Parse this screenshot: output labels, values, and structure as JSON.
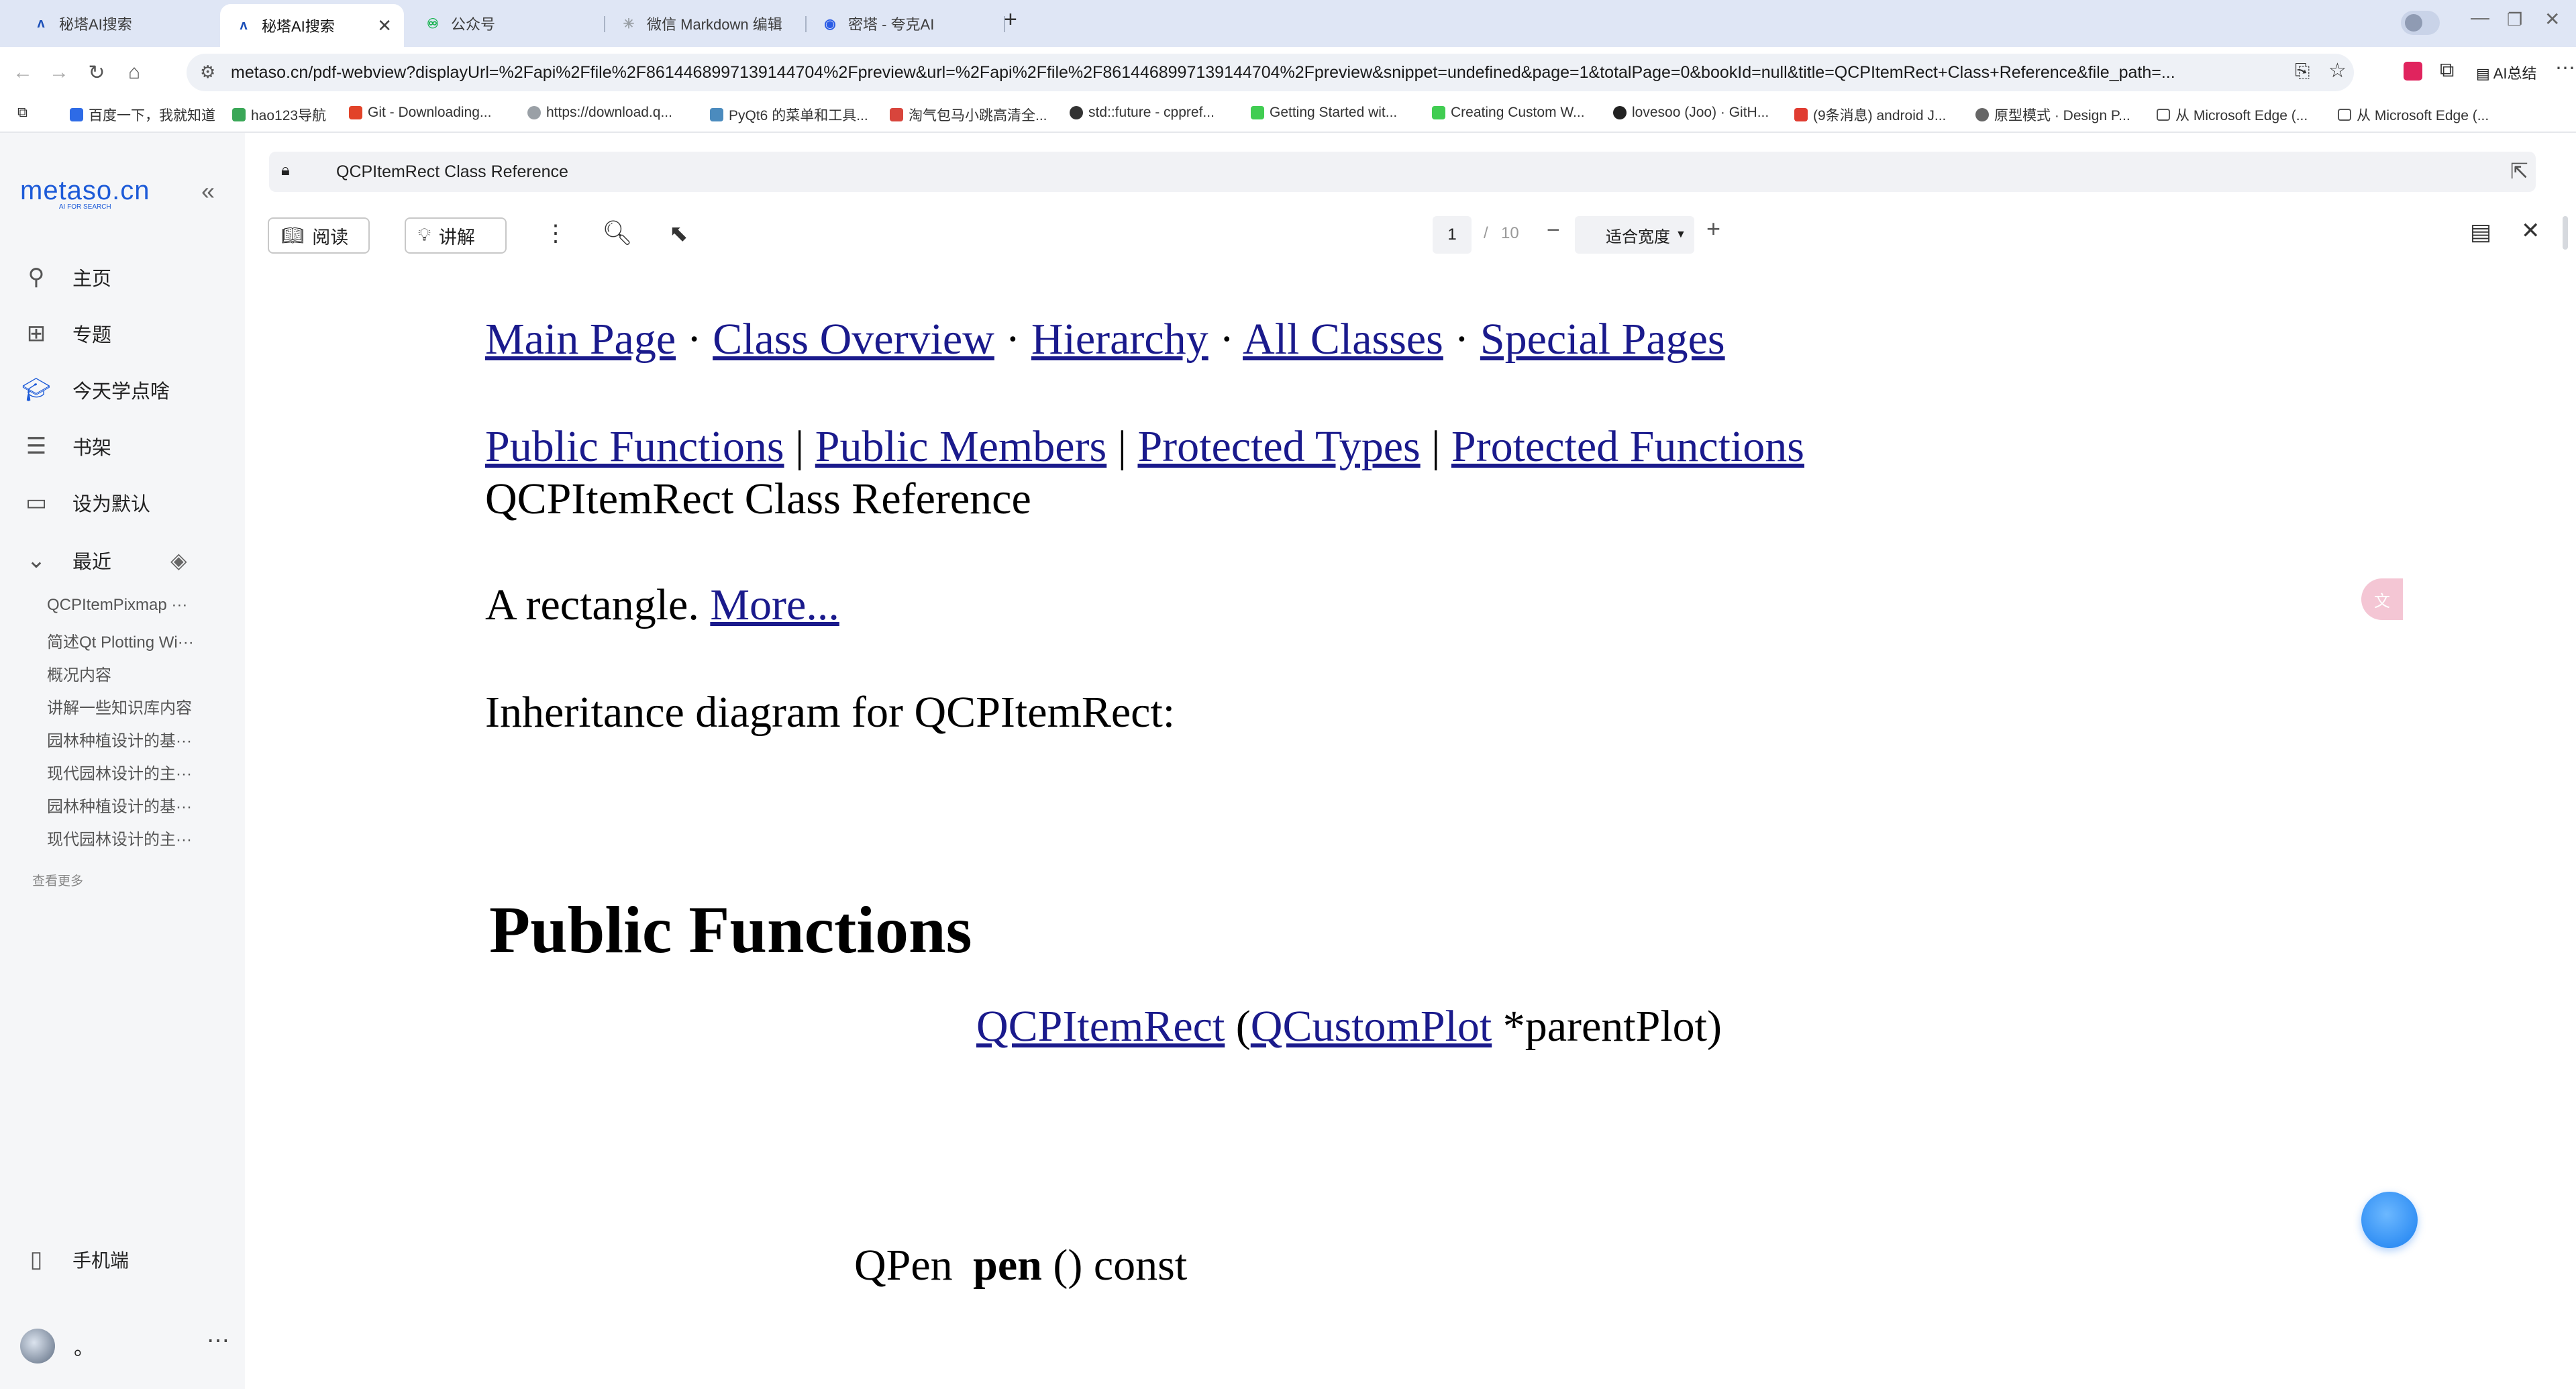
{
  "browser": {
    "tabs": [
      {
        "title": "秘塔AI搜索",
        "icon": "metaso-icon"
      },
      {
        "title": "秘塔AI搜索",
        "icon": "metaso-icon",
        "active": true
      },
      {
        "title": "公众号",
        "icon": "wechat-mp-icon"
      },
      {
        "title": "微信 Markdown 编辑",
        "icon": "loading-icon"
      },
      {
        "title": "密塔 - 夸克AI",
        "icon": "quark-icon"
      }
    ],
    "new_tab": "+",
    "url": "metaso.cn/pdf-webview?displayUrl=%2Fapi%2Ffile%2F8614468997139144704%2Fpreview&url=%2Fapi%2Ffile%2F8614468997139144704%2Fpreview&snippet=undefined&page=1&totalPage=0&bookId=null&title=QCPItemRect+Class+Reference&file_path=...",
    "ai_summary": "AI总结",
    "bookmarks": [
      "百度一下，我就知道",
      "hao123导航",
      "Git - Downloading...",
      "https://download.q...",
      "PyQt6 的菜单和工具...",
      "淘气包马小跳高清全...",
      "std::future - cppref...",
      "Getting Started wit...",
      "Creating Custom W...",
      "lovesoo (Joo) · GitH...",
      "(9条消息) android J...",
      "原型模式 · Design P...",
      "从 Microsoft Edge (...",
      "从 Microsoft Edge (..."
    ]
  },
  "sidebar": {
    "logo": "metaso.cn",
    "logo_sub": "AI FOR SEARCH",
    "nav": [
      {
        "label": "主页",
        "icon": "search-icon"
      },
      {
        "label": "专题",
        "icon": "grid-icon"
      },
      {
        "label": "今天学点啥",
        "icon": "graduation-cap-icon"
      },
      {
        "label": "书架",
        "icon": "bookshelf-icon"
      },
      {
        "label": "设为默认",
        "icon": "window-icon"
      }
    ],
    "recent_label": "最近",
    "recent_items": [
      "QCPItemPixmap ···",
      "简述Qt Plotting Wi···",
      "概况内容",
      "讲解一些知识库内容",
      "园林种植设计的基···",
      "现代园林设计的主···",
      "园林种植设计的基···",
      "现代园林设计的主···"
    ],
    "see_more": "查看更多",
    "mobile": "手机端",
    "user_name": "。"
  },
  "viewer": {
    "doc_title": "QCPItemRect Class Reference",
    "read_btn": "阅读",
    "explain_btn": "讲解",
    "page_current": "1",
    "page_sep": "/",
    "page_total": "10",
    "zoom_label": "适合宽度",
    "zoom_minus": "−",
    "zoom_plus": "+"
  },
  "doc": {
    "nav_links": [
      "Main Page",
      "Class Overview",
      "Hierarchy",
      "All Classes",
      "Special Pages"
    ],
    "nav_sep": "·",
    "section_links": [
      "Public Functions",
      "Public Members",
      "Protected Types",
      "Protected Functions"
    ],
    "section_sep": "|",
    "class_title": "QCPItemRect Class Reference",
    "brief": "A rectangle.",
    "more_link": "More...",
    "inheritance": "Inheritance diagram for QCPItemRect:",
    "public_functions_heading": "Public Functions",
    "ctor_name": "QCPItemRect",
    "ctor_open": "(",
    "ctor_param_type": "QCustomPlot",
    "ctor_param_rest": "*parentPlot)",
    "pen_type": "QPen",
    "pen_name": "pen",
    "pen_rest": "() const"
  }
}
